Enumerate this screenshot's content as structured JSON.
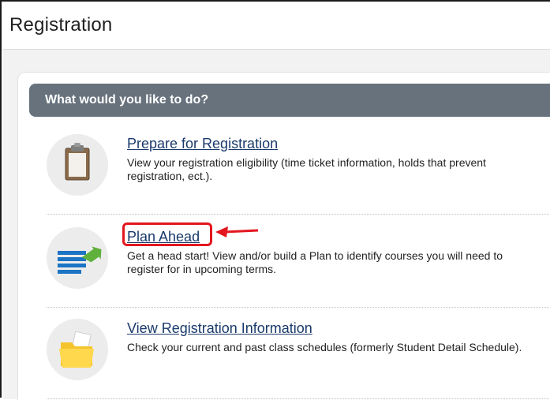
{
  "header": {
    "title": "Registration"
  },
  "card": {
    "heading": "What would you like to do?"
  },
  "items": [
    {
      "icon": "clipboard-icon",
      "link": "Prepare for Registration",
      "description": "View your registration eligibility (time ticket information, holds that prevent registration, ect.)."
    },
    {
      "icon": "plan-list-icon",
      "link": "Plan Ahead",
      "description": "Get a head start! View and/or build a Plan to identify courses you will need to register for in upcoming terms."
    },
    {
      "icon": "folder-icon",
      "link": "View Registration Information",
      "description": "Check your current and past class schedules (formerly Student Detail Schedule)."
    }
  ],
  "annotation": {
    "color": "#e3161e"
  }
}
